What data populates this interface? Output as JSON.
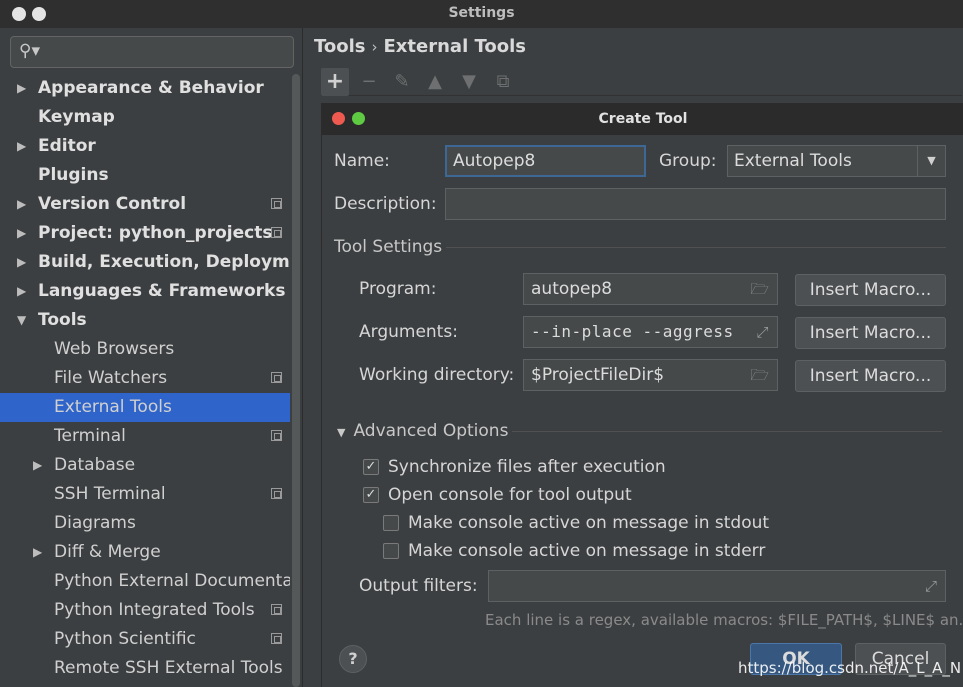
{
  "window": {
    "title": "Settings"
  },
  "sidebar": {
    "items": [
      {
        "label": "Appearance & Behavior",
        "level": "top",
        "arrow": "right",
        "config": false
      },
      {
        "label": "Keymap",
        "level": "top",
        "arrow": "",
        "config": false
      },
      {
        "label": "Editor",
        "level": "top",
        "arrow": "right",
        "config": false
      },
      {
        "label": "Plugins",
        "level": "top",
        "arrow": "",
        "config": false
      },
      {
        "label": "Version Control",
        "level": "top",
        "arrow": "right",
        "config": true
      },
      {
        "label": "Project: python_projects",
        "level": "top",
        "arrow": "right",
        "config": true
      },
      {
        "label": "Build, Execution, Deploymen",
        "level": "top",
        "arrow": "right",
        "config": false
      },
      {
        "label": "Languages & Frameworks",
        "level": "top",
        "arrow": "right",
        "config": false
      },
      {
        "label": "Tools",
        "level": "top",
        "arrow": "down",
        "config": false
      },
      {
        "label": "Web Browsers",
        "level": "sub",
        "arrow": "",
        "config": false
      },
      {
        "label": "File Watchers",
        "level": "sub",
        "arrow": "",
        "config": true
      },
      {
        "label": "External Tools",
        "level": "sub",
        "arrow": "",
        "config": false,
        "selected": true
      },
      {
        "label": "Terminal",
        "level": "sub",
        "arrow": "",
        "config": true
      },
      {
        "label": "Database",
        "level": "sub",
        "arrow": "right",
        "config": false
      },
      {
        "label": "SSH Terminal",
        "level": "sub",
        "arrow": "",
        "config": true
      },
      {
        "label": "Diagrams",
        "level": "sub",
        "arrow": "",
        "config": false
      },
      {
        "label": "Diff & Merge",
        "level": "sub",
        "arrow": "right",
        "config": false
      },
      {
        "label": "Python External Documentat",
        "level": "sub",
        "arrow": "",
        "config": false
      },
      {
        "label": "Python Integrated Tools",
        "level": "sub",
        "arrow": "",
        "config": true
      },
      {
        "label": "Python Scientific",
        "level": "sub",
        "arrow": "",
        "config": true
      },
      {
        "label": "Remote SSH External Tools",
        "level": "sub",
        "arrow": "",
        "config": false
      }
    ]
  },
  "breadcrumb": {
    "parent": "Tools",
    "sep": "›",
    "current": "External Tools"
  },
  "toolbar": {
    "icons": [
      "add-icon",
      "remove-icon",
      "edit-icon",
      "move-up-icon",
      "move-down-icon",
      "copy-icon"
    ]
  },
  "dialog": {
    "title": "Create Tool",
    "name_label": "Name:",
    "name_value": "Autopep8",
    "group_label": "Group:",
    "group_value": "External Tools",
    "description_label": "Description:",
    "description_value": "",
    "tool_settings_label": "Tool Settings",
    "program_label": "Program:",
    "program_value": "autopep8",
    "arguments_label": "Arguments:",
    "arguments_value": "--in-place --aggress",
    "workdir_label": "Working directory:",
    "workdir_value": "$ProjectFileDir$",
    "insert_macro": "Insert Macro...",
    "advanced_label": "Advanced Options",
    "sync_label": "Synchronize files after execution",
    "sync_checked": true,
    "console_label": "Open console for tool output",
    "console_checked": true,
    "stdout_label": "Make console active on message in stdout",
    "stdout_checked": false,
    "stderr_label": "Make console active on message in stderr",
    "stderr_checked": false,
    "output_filters_label": "Output filters:",
    "output_filters_value": "",
    "hint": "Each line is a regex, available macros: $FILE_PATH$, $LINE$ an...",
    "help": "?",
    "ok": "OK",
    "cancel": "Cancel"
  },
  "watermark": "https://blog.csdn.net/A_L_A_N"
}
